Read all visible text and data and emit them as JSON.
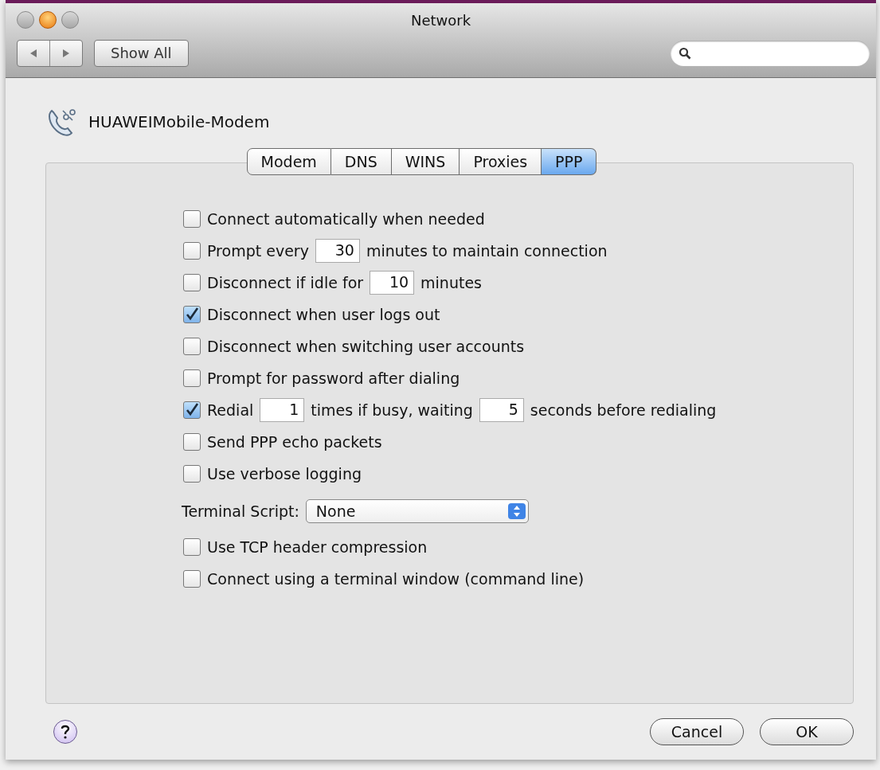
{
  "window": {
    "title": "Network"
  },
  "toolbar": {
    "show_all": "Show All"
  },
  "device": {
    "name": "HUAWEIMobile-Modem"
  },
  "tabs": [
    {
      "label": "Modem",
      "selected": false
    },
    {
      "label": "DNS",
      "selected": false
    },
    {
      "label": "WINS",
      "selected": false
    },
    {
      "label": "Proxies",
      "selected": false
    },
    {
      "label": "PPP",
      "selected": true
    }
  ],
  "options": [
    {
      "kind": "checkbox",
      "checked": false,
      "parts": [
        {
          "text": "Connect automatically when needed"
        }
      ]
    },
    {
      "kind": "checkbox",
      "checked": false,
      "parts": [
        {
          "text": "Prompt every"
        },
        {
          "field": "30"
        },
        {
          "text": "minutes to maintain connection"
        }
      ]
    },
    {
      "kind": "checkbox",
      "checked": false,
      "parts": [
        {
          "text": "Disconnect if idle for"
        },
        {
          "field": "10"
        },
        {
          "text": "minutes"
        }
      ]
    },
    {
      "kind": "checkbox",
      "checked": true,
      "parts": [
        {
          "text": "Disconnect when user logs out"
        }
      ]
    },
    {
      "kind": "checkbox",
      "checked": false,
      "parts": [
        {
          "text": "Disconnect when switching user accounts"
        }
      ]
    },
    {
      "kind": "checkbox",
      "checked": false,
      "parts": [
        {
          "text": "Prompt for password after dialing"
        }
      ]
    },
    {
      "kind": "checkbox",
      "checked": true,
      "parts": [
        {
          "text": "Redial"
        },
        {
          "field": "1"
        },
        {
          "text": "times if busy, waiting"
        },
        {
          "field": "5"
        },
        {
          "text": "seconds before redialing"
        }
      ]
    },
    {
      "kind": "checkbox",
      "checked": false,
      "parts": [
        {
          "text": "Send PPP echo packets"
        }
      ]
    },
    {
      "kind": "checkbox",
      "checked": false,
      "parts": [
        {
          "text": "Use verbose logging"
        }
      ]
    },
    {
      "kind": "popup",
      "label": "Terminal Script:",
      "value": "None"
    },
    {
      "kind": "checkbox",
      "checked": false,
      "parts": [
        {
          "text": "Use TCP header compression"
        }
      ]
    },
    {
      "kind": "checkbox",
      "checked": false,
      "parts": [
        {
          "text": "Connect using a terminal window (command line)"
        }
      ]
    }
  ],
  "buttons": [
    {
      "label": "Cancel",
      "default": false
    },
    {
      "label": "OK",
      "default": false
    }
  ]
}
